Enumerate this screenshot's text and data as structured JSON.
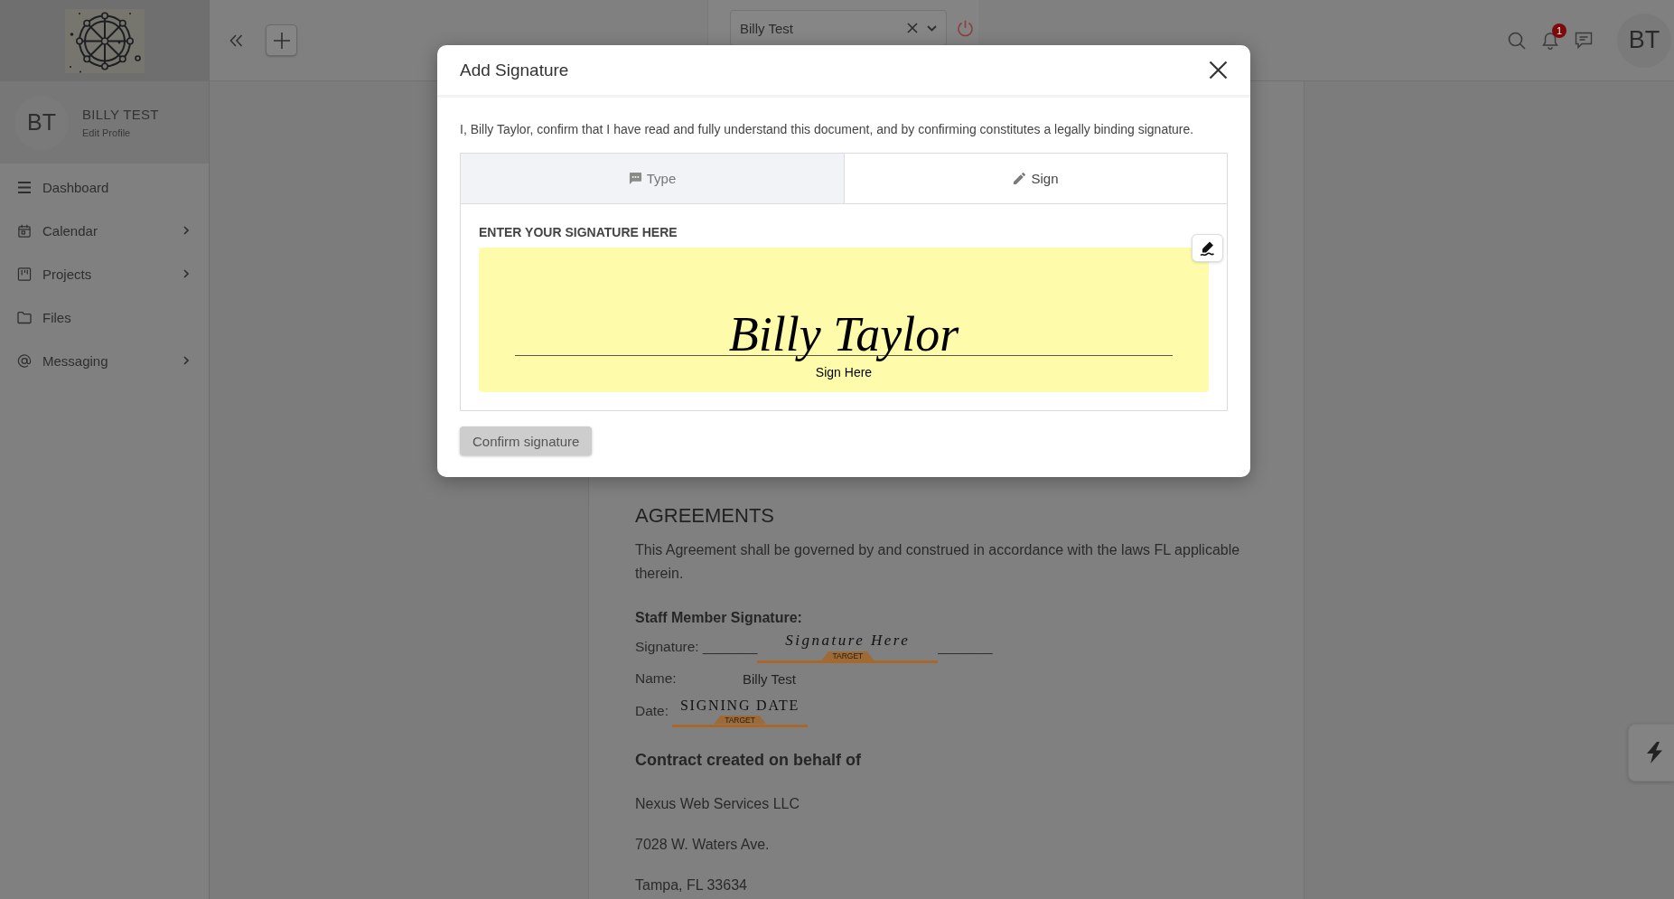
{
  "sidebar": {
    "profile": {
      "initials": "BT",
      "name": "BILLY TEST",
      "link": "Edit Profile"
    },
    "items": [
      {
        "label": "Dashboard",
        "submenu": false,
        "selected": false
      },
      {
        "label": "Calendar",
        "submenu": true,
        "selected": false
      },
      {
        "label": "Projects",
        "submenu": true,
        "selected": false
      },
      {
        "label": "Files",
        "submenu": false,
        "selected": false
      },
      {
        "label": "Messaging",
        "submenu": true,
        "selected": false
      }
    ]
  },
  "topbar": {
    "user_select": {
      "value": "Billy Test"
    },
    "notifications": {
      "count": "1"
    },
    "avatar": {
      "initials": "BT"
    }
  },
  "document": {
    "heading": "AGREEMENTS",
    "paragraph": "This Agreement shall be governed by and construed in accordance with the laws FL applicable therein.",
    "signature_block": {
      "title": "Staff Member Signature:",
      "rows": [
        {
          "kind": "signature",
          "label": "Signature:",
          "blank_before": "_______",
          "prompt": "Signature Here",
          "tag": "TARGET",
          "blank_after": "_______"
        },
        {
          "kind": "text",
          "label": "Name:",
          "value": "Billy Test"
        },
        {
          "kind": "date",
          "label": "Date:",
          "prompt": "SIGNING DATE",
          "tag": "TARGET"
        }
      ]
    },
    "contract_heading": "Contract created on behalf of",
    "address_lines": [
      "Nexus Web Services LLC",
      "7028 W. Waters Ave.",
      "Tampa, FL 33634"
    ]
  },
  "dialog": {
    "title": "Add Signature",
    "statement": "I, Billy Taylor, confirm that I have read and fully understand this document, and by confirming constitutes a legally binding signature.",
    "tabs": [
      {
        "label": "Type",
        "selected": false
      },
      {
        "label": "Sign",
        "selected": true
      }
    ],
    "pad_label": "ENTER YOUR SIGNATURE HERE",
    "signature": "Billy Taylor",
    "line_caption": "Sign Here",
    "confirm_button": {
      "label": "Confirm signature",
      "disabled": true
    }
  }
}
